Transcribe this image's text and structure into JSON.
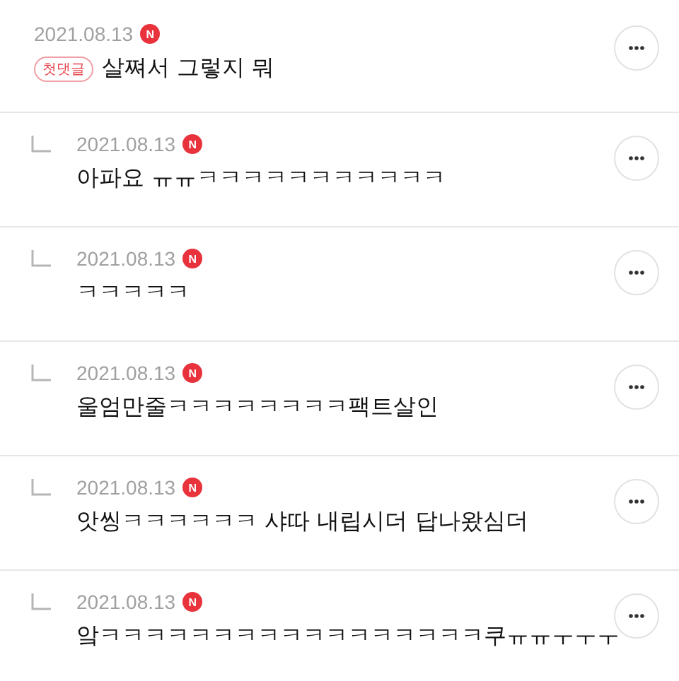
{
  "comments": [
    {
      "kind": "comment",
      "date": "2021.08.13",
      "new_badge": "N",
      "tag": "첫댓글",
      "text": "살쪄서 그렇지 뭐"
    },
    {
      "kind": "reply",
      "date": "2021.08.13",
      "new_badge": "N",
      "text": "아파요 ㅠㅠㅋㅋㅋㅋㅋㅋㅋㅋㅋㅋㅋ"
    },
    {
      "kind": "reply",
      "date": "2021.08.13",
      "new_badge": "N",
      "text": "ㅋㅋㅋㅋㅋ"
    },
    {
      "kind": "reply",
      "date": "2021.08.13",
      "new_badge": "N",
      "text": "울엄만줄ㅋㅋㅋㅋㅋㅋㅋㅋ팩트살인"
    },
    {
      "kind": "reply",
      "date": "2021.08.13",
      "new_badge": "N",
      "text": "앗씽ㅋㅋㅋㅋㅋㅋ 샤따 내립시더 답나왔심더"
    },
    {
      "kind": "reply",
      "date": "2021.08.13",
      "new_badge": "N",
      "text": "앜ㅋㅋㅋㅋㅋㅋㅋㅋㅋㅋㅋㅋㅋㅋㅋㅋㅋ쿠ㅠㅠㅜㅜㅜ"
    }
  ]
}
